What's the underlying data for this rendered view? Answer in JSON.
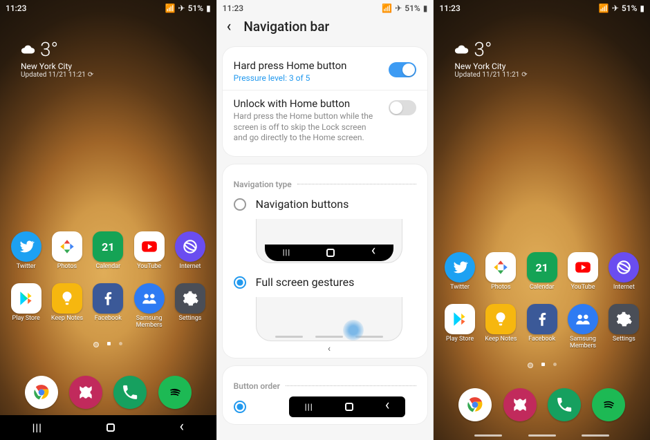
{
  "status": {
    "time": "11:23",
    "indicators": "⬛",
    "signal_icons": "▮▮ ✈ 51% 🔋"
  },
  "weather": {
    "temp": "3°",
    "city": "New York City",
    "updated": "Updated 11/21 11:21"
  },
  "apps_row1": [
    {
      "label": "Twitter",
      "key": "twitter"
    },
    {
      "label": "Photos",
      "key": "photos"
    },
    {
      "label": "Calendar",
      "key": "calendar",
      "badge": "21"
    },
    {
      "label": "YouTube",
      "key": "youtube"
    },
    {
      "label": "Internet",
      "key": "internet"
    }
  ],
  "apps_row2": [
    {
      "label": "Play Store",
      "key": "playstore"
    },
    {
      "label": "Keep Notes",
      "key": "keepnotes"
    },
    {
      "label": "Facebook",
      "key": "facebook"
    },
    {
      "label": "Samsung Members",
      "key": "members"
    },
    {
      "label": "Settings",
      "key": "settings"
    }
  ],
  "dock": [
    {
      "label": "Chrome",
      "key": "chrome"
    },
    {
      "label": "Gallery",
      "key": "gallery"
    },
    {
      "label": "Phone",
      "key": "phone"
    },
    {
      "label": "Spotify",
      "key": "spotify"
    }
  ],
  "settings": {
    "title": "Navigation bar",
    "row1": {
      "title": "Hard press Home button",
      "desc": "Pressure level: 3 of 5",
      "on": true
    },
    "row2": {
      "title": "Unlock with Home button",
      "sub": "Hard press the Home button while the screen is off to skip the Lock screen and go directly to the Home screen.",
      "on": false
    },
    "section_navtype": "Navigation type",
    "opt1": "Navigation buttons",
    "opt2": "Full screen gestures",
    "section_btnorder": "Button order"
  }
}
